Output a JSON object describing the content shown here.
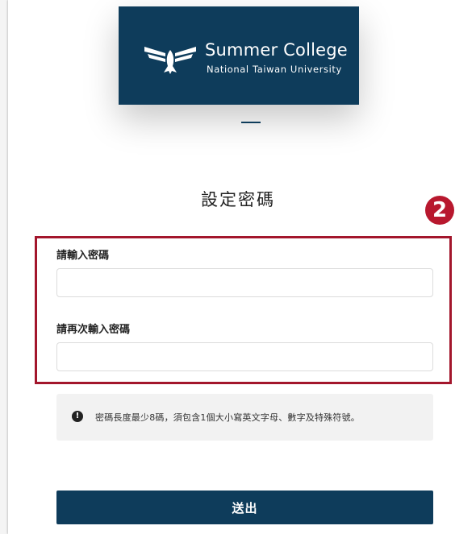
{
  "brand": {
    "title": "Summer College",
    "subtitle": "National Taiwan University",
    "colors": {
      "primary": "#0e3c5b",
      "highlight": "#a3162c",
      "badge": "#b8182e"
    }
  },
  "page": {
    "title": "設定密碼"
  },
  "annotation": {
    "step_number": "2"
  },
  "form": {
    "password_label": "請輸入密碼",
    "password_value": "",
    "confirm_label": "請再次輸入密碼",
    "confirm_value": ""
  },
  "notice": {
    "icon": "exclamation-circle-icon",
    "text": "密碼長度最少8碼，須包含1個大小寫英文字母、數字及特殊符號。"
  },
  "actions": {
    "submit_label": "送出"
  }
}
